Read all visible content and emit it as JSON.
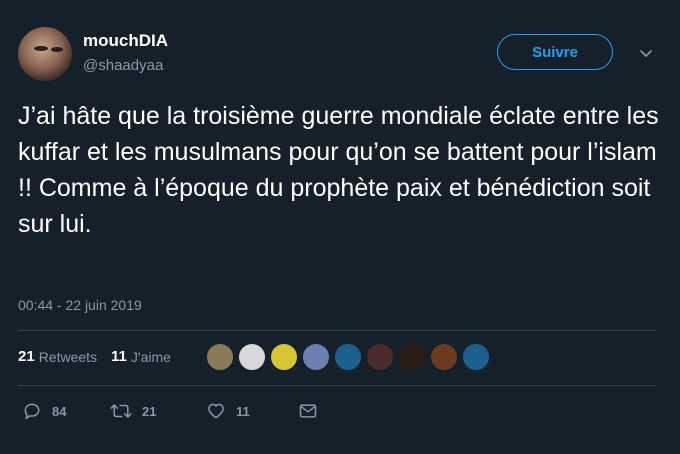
{
  "user": {
    "display_name": "mouchDIA",
    "handle": "@shaadyaa"
  },
  "follow_label": "Suivre",
  "tweet": {
    "text": "J’ai hâte que la troisième guerre mondiale éclate entre les kuffar et les musulmans pour qu’on se battent pour l’islam !! Comme à l’époque du prophète paix et bénédiction soit sur lui.",
    "timestamp": "00:44 - 22 juin 2019"
  },
  "stats": {
    "retweets_count": "21",
    "retweets_label": "Retweets",
    "likes_count": "11",
    "likes_label": "J'aime"
  },
  "likers": [
    {
      "color": "#8a7a55"
    },
    {
      "color": "#d7d7d7"
    },
    {
      "color": "#d6c430"
    },
    {
      "color": "#6a7fb0"
    },
    {
      "color": "#1d5f8f"
    },
    {
      "color": "#4a2c2c"
    },
    {
      "color": "#2b1d16"
    },
    {
      "color": "#6b3b1f"
    },
    {
      "color": "#1d5f8f"
    }
  ],
  "actions": {
    "reply_count": "84",
    "retweet_count": "21",
    "like_count": "11"
  },
  "colors": {
    "background": "#15202b",
    "accent": "#1da1f2",
    "muted": "#8899a6",
    "divider": "#38444d"
  }
}
